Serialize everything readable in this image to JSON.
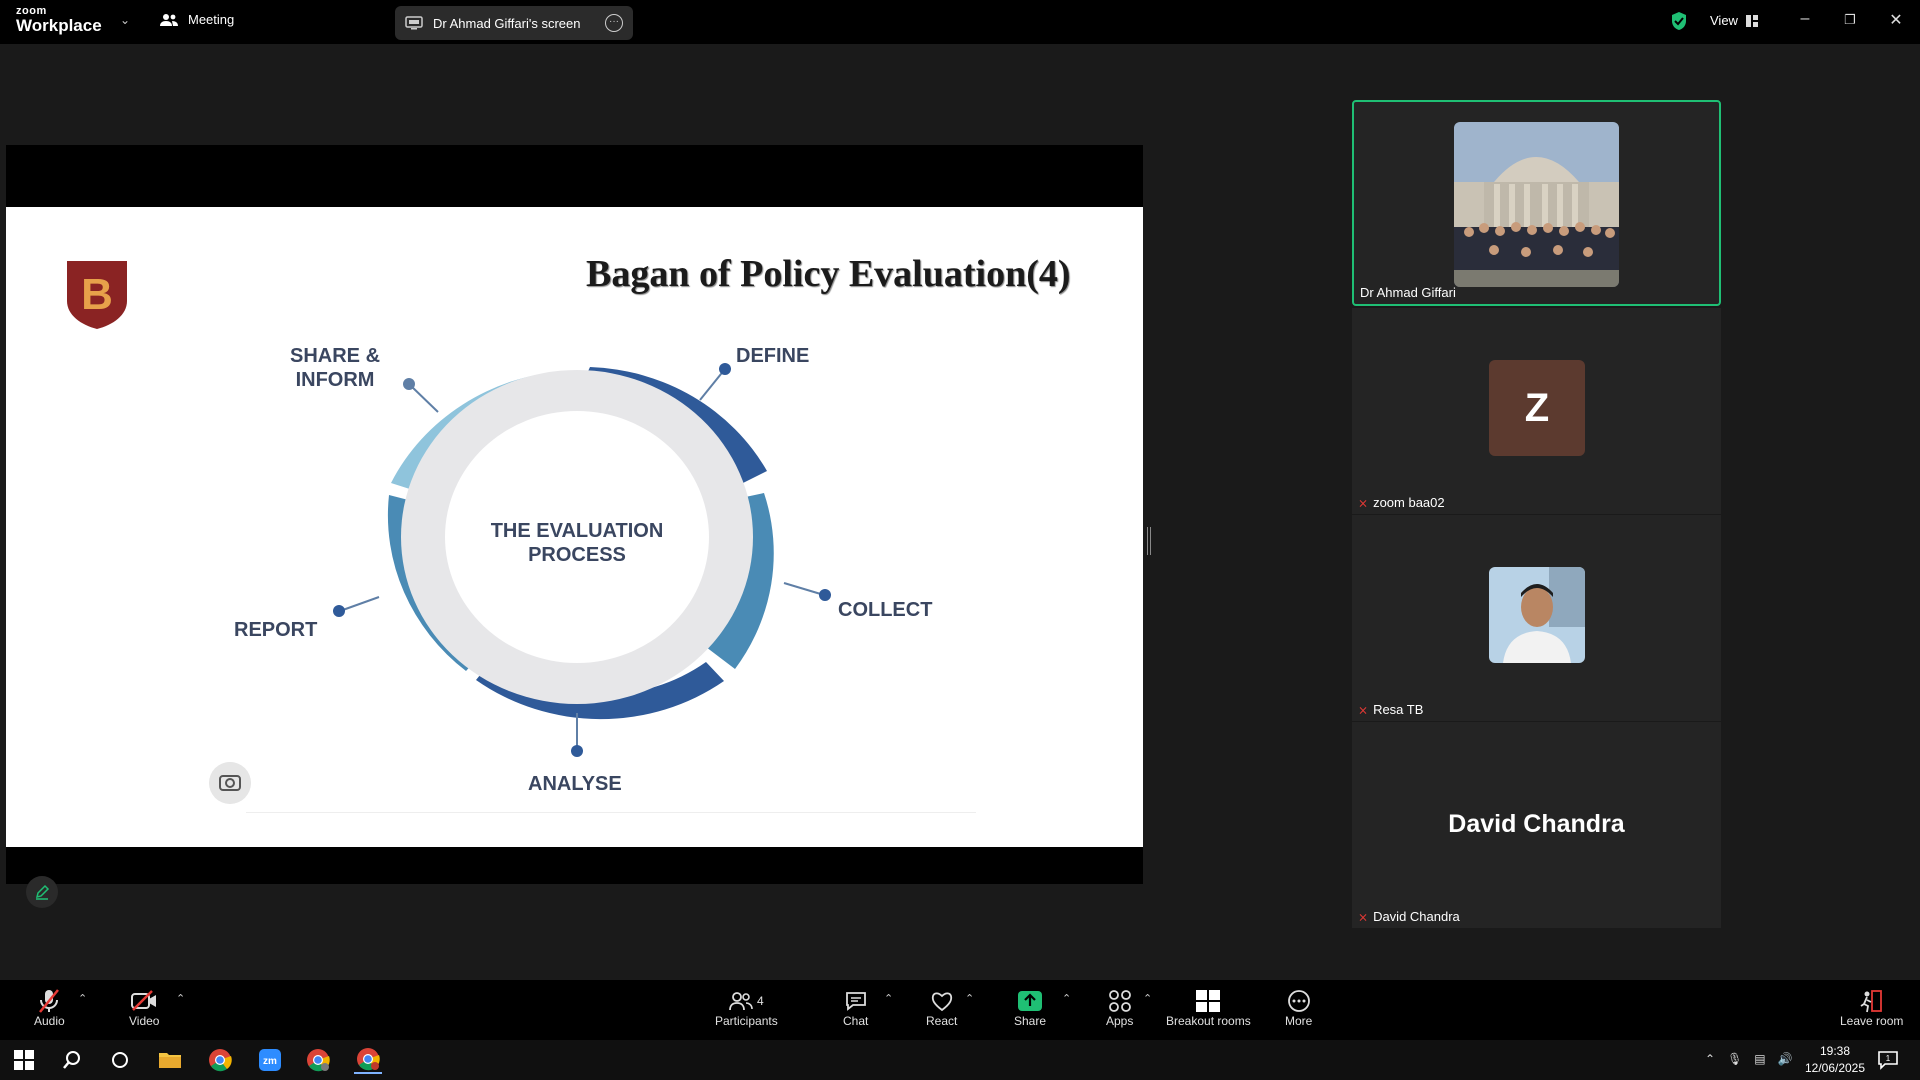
{
  "app": {
    "logo_top": "zoom",
    "logo_bottom": "Workplace",
    "meeting_label": "Meeting",
    "screen_share_label": "Dr Ahmad Giffari's screen",
    "view_label": "View"
  },
  "slide": {
    "title": "Bagan of Policy Evaluation(4)",
    "logo_letter": "B",
    "center_text_line1": "THE EVALUATION",
    "center_text_line2": "PROCESS",
    "steps": [
      {
        "label_line1": "DEFINE",
        "label_line2": ""
      },
      {
        "label_line1": "COLLECT",
        "label_line2": ""
      },
      {
        "label_line1": "ANALYSE",
        "label_line2": ""
      },
      {
        "label_line1": "REPORT",
        "label_line2": ""
      },
      {
        "label_line1": "SHARE &",
        "label_line2": "INFORM"
      }
    ],
    "colors": {
      "dark_blue": "#2f5a99",
      "mid_blue": "#4a8bb5",
      "light_blue": "#8fc4dc",
      "ring": "#e7e7e9"
    }
  },
  "participants": [
    {
      "name": "Dr Ahmad Giffari",
      "muted": false,
      "avatar": "photo-group",
      "active": true
    },
    {
      "name": "zoom baa02",
      "muted": true,
      "avatar_letter": "Z",
      "active": false
    },
    {
      "name": "Resa TB",
      "muted": true,
      "avatar": "photo-portrait",
      "active": false
    },
    {
      "name": "David Chandra",
      "muted": true,
      "display_text": "David Chandra",
      "active": false
    }
  ],
  "toolbar": {
    "audio": "Audio",
    "video": "Video",
    "participants": "Participants",
    "participants_count": "4",
    "chat": "Chat",
    "react": "React",
    "share": "Share",
    "apps": "Apps",
    "breakout": "Breakout rooms",
    "more": "More",
    "leave": "Leave room"
  },
  "taskbar": {
    "time": "19:38",
    "date": "12/06/2025",
    "notification_count": "1"
  }
}
